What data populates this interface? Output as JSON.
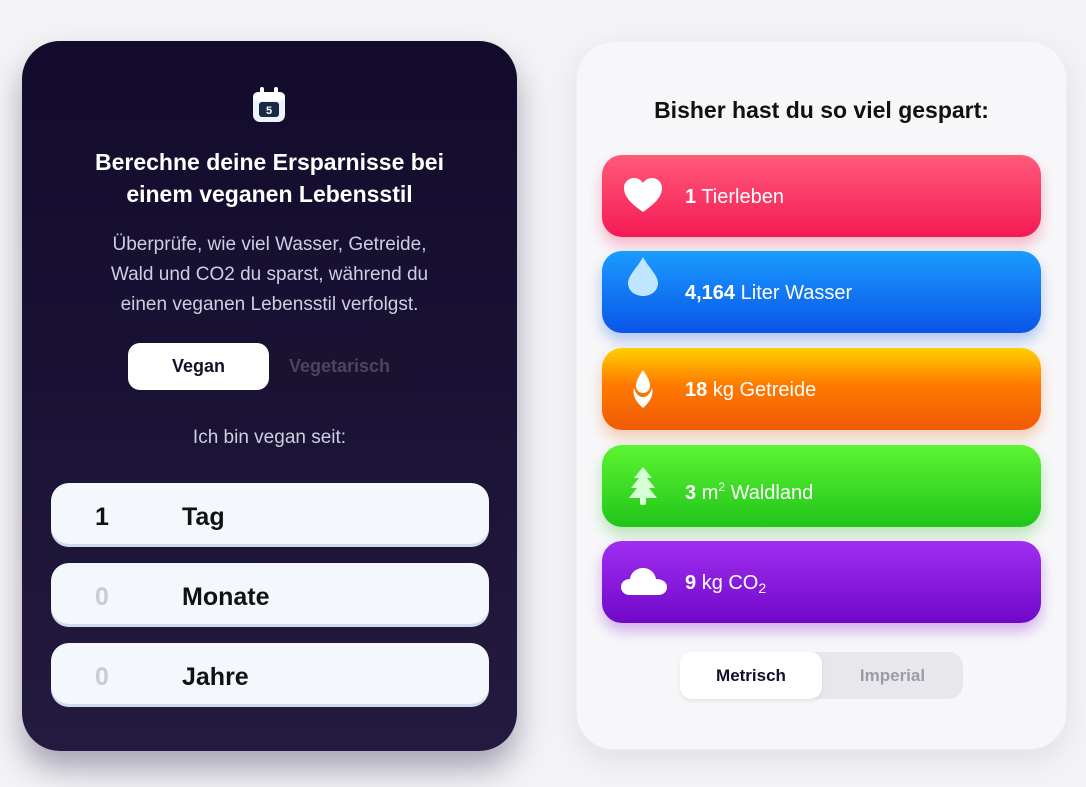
{
  "calculator": {
    "calendar_day": "5",
    "title_line1": "Berechne deine Ersparnisse bei",
    "title_line2": "einem veganen Lebensstil",
    "desc_line1": "Überprüfe, wie viel Wasser, Getreide,",
    "desc_line2": "Wald und CO2 du sparst, während du",
    "desc_line3": "einen veganen Lebensstil verfolgst.",
    "diet_toggle": {
      "vegan": "Vegan",
      "vegetarian": "Vegetarisch",
      "selected": "Vegan"
    },
    "since_label": "Ich bin vegan seit:",
    "durations": [
      {
        "value": "1",
        "unit": "Tag"
      },
      {
        "value": "0",
        "unit": "Monate"
      },
      {
        "value": "0",
        "unit": "Jahre"
      }
    ]
  },
  "savings": {
    "title": "Bisher hast du so viel gespart:",
    "items": [
      {
        "value": "1",
        "label": "Tierleben",
        "icon": "heart-icon",
        "color": "#f51a54"
      },
      {
        "value": "4,164",
        "label": "Liter Wasser",
        "icon": "water-drop-icon",
        "color": "#0a55e6"
      },
      {
        "value": "18",
        "label": "kg Getreide",
        "icon": "grain-icon",
        "color": "#ff7a00"
      },
      {
        "value": "3",
        "unit_base": "m",
        "unit_sup": "2",
        "label": "Waldland",
        "icon": "tree-icon",
        "color": "#21c41a"
      },
      {
        "value": "9",
        "unit_base": "kg CO",
        "unit_sub": "2",
        "icon": "cloud-icon",
        "color": "#7008c8"
      }
    ],
    "unit_toggle": {
      "metric": "Metrisch",
      "imperial": "Imperial",
      "selected": "Metrisch"
    }
  }
}
